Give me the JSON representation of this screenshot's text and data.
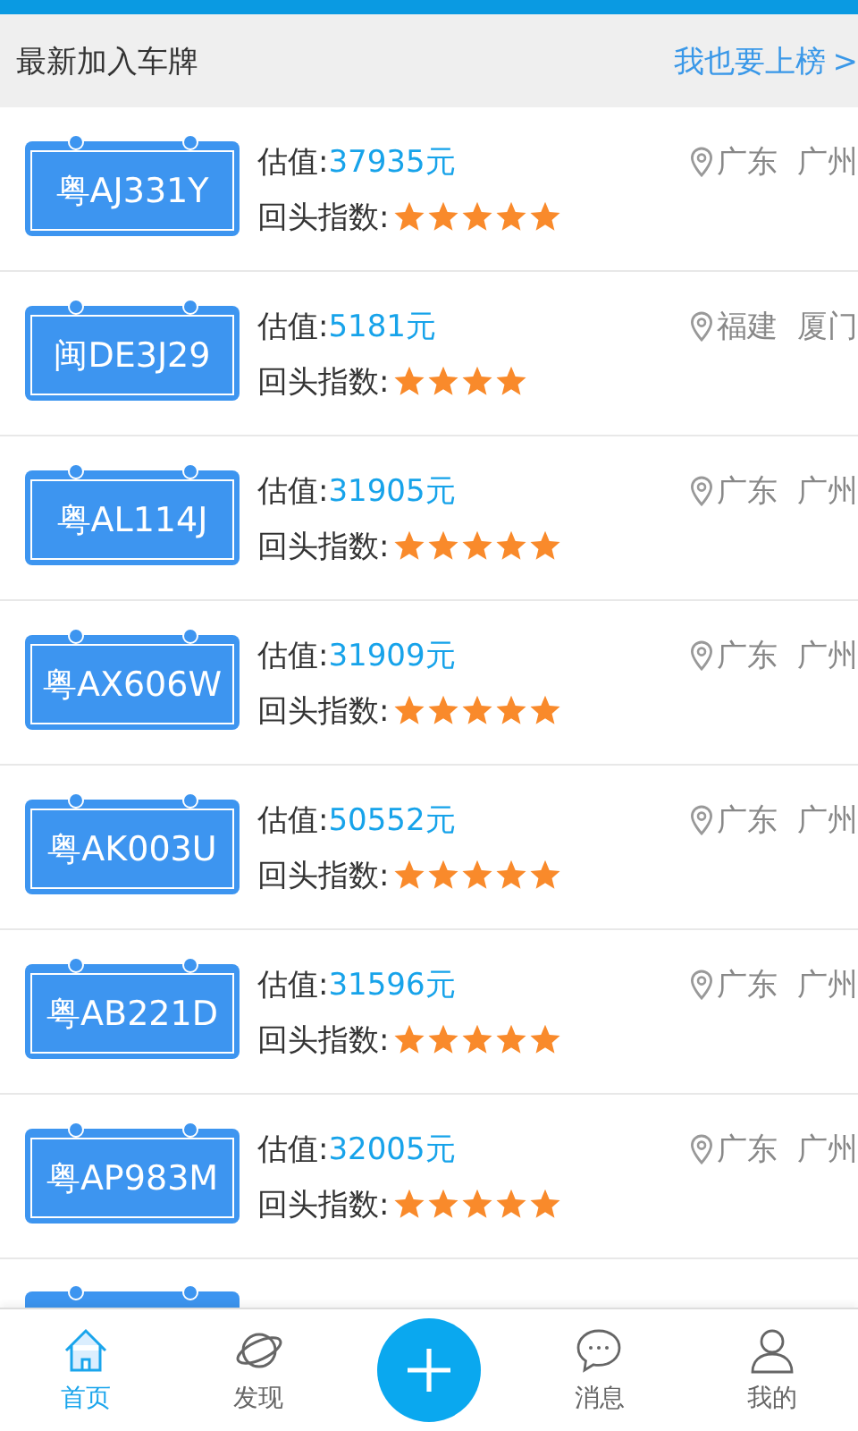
{
  "header": {
    "title": "最新加入车牌",
    "link": "我也要上榜",
    "link_arrow": ">"
  },
  "plates": [
    {
      "plate": "粤AJ331Y",
      "value_label": "估值:",
      "value": "37935元",
      "location": "广东  广州",
      "index_label": "回头指数:",
      "stars": 5
    },
    {
      "plate": "闽DE3J29",
      "value_label": "估值:",
      "value": "5181元",
      "location": "福建  厦门",
      "index_label": "回头指数:",
      "stars": 4
    },
    {
      "plate": "粤AL114J",
      "value_label": "估值:",
      "value": "31905元",
      "location": "广东  广州",
      "index_label": "回头指数:",
      "stars": 5
    },
    {
      "plate": "粤AX606W",
      "value_label": "估值:",
      "value": "31909元",
      "location": "广东  广州",
      "index_label": "回头指数:",
      "stars": 5
    },
    {
      "plate": "粤AK003U",
      "value_label": "估值:",
      "value": "50552元",
      "location": "广东  广州",
      "index_label": "回头指数:",
      "stars": 5
    },
    {
      "plate": "粤AB221D",
      "value_label": "估值:",
      "value": "31596元",
      "location": "广东  广州",
      "index_label": "回头指数:",
      "stars": 5
    },
    {
      "plate": "粤AP983M",
      "value_label": "估值:",
      "value": "32005元",
      "location": "广东  广州",
      "index_label": "回头指数:",
      "stars": 5
    }
  ],
  "nav": [
    {
      "kind": "home",
      "label": "首页",
      "selected": true
    },
    {
      "kind": "discover",
      "label": "发现",
      "selected": false
    },
    {
      "kind": "add",
      "selected": false
    },
    {
      "kind": "message",
      "label": "消息",
      "selected": false
    },
    {
      "kind": "me",
      "label": "我的",
      "selected": false
    }
  ]
}
